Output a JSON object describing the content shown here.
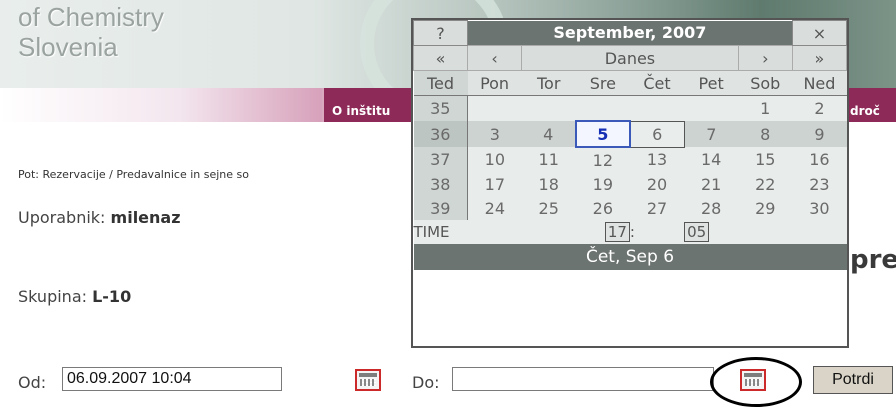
{
  "header": {
    "org_line1": "of Chemistry",
    "org_line2": "Slovenia",
    "nav_item_1": "O inštitu",
    "nav_item_2": "droč"
  },
  "content": {
    "path": "Pot: Rezervacije / Predavalnice in sejne so",
    "user_label": "Uporabnik: ",
    "user_value": "milenaz",
    "group_label": "Skupina: ",
    "group_value": "L-10",
    "big_text": "pre"
  },
  "form": {
    "od_label": "Od:",
    "od_value": "06.09.2007 10:04",
    "do_label": "Do:",
    "do_value": "",
    "submit_label": "Potrdi"
  },
  "calendar": {
    "help": "?",
    "title": "September, 2007",
    "close": "×",
    "prev_year": "«",
    "prev_month": "‹",
    "today_label": "Danes",
    "next_month": "›",
    "next_year": "»",
    "weekday_headers": [
      "Ted",
      "Pon",
      "Tor",
      "Sre",
      "Čet",
      "Pet",
      "Sob",
      "Ned"
    ],
    "weeks": [
      {
        "wk": "35",
        "days": [
          "",
          "",
          "",
          "",
          "",
          "1",
          "2"
        ]
      },
      {
        "wk": "36",
        "days": [
          "3",
          "4",
          "5",
          "6",
          "7",
          "8",
          "9"
        ]
      },
      {
        "wk": "37",
        "days": [
          "10",
          "11",
          "12",
          "13",
          "14",
          "15",
          "16"
        ]
      },
      {
        "wk": "38",
        "days": [
          "17",
          "18",
          "19",
          "20",
          "21",
          "22",
          "23"
        ]
      },
      {
        "wk": "39",
        "days": [
          "24",
          "25",
          "26",
          "27",
          "28",
          "29",
          "30"
        ]
      }
    ],
    "time_label": "TIME",
    "hour": "17",
    "time_sep": ":",
    "minute": "05",
    "status": "Čet, Sep 6"
  }
}
